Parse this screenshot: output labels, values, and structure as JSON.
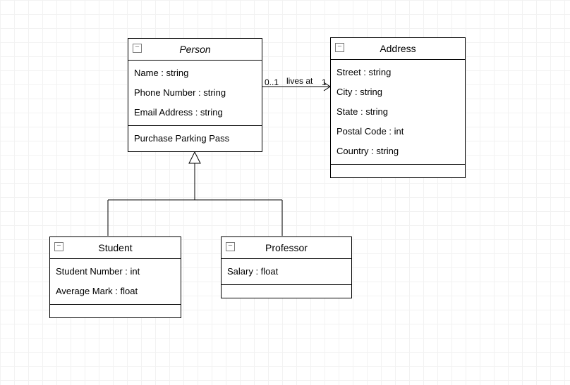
{
  "classes": {
    "person": {
      "name": "Person",
      "abstract": true,
      "attributes": [
        "Name : string",
        "Phone Number : string",
        "Email Address : string"
      ],
      "operations": [
        "Purchase Parking Pass"
      ]
    },
    "address": {
      "name": "Address",
      "abstract": false,
      "attributes": [
        "Street : string",
        "City : string",
        "State : string",
        "Postal Code : int",
        "Country : string"
      ],
      "operations": []
    },
    "student": {
      "name": "Student",
      "abstract": false,
      "attributes": [
        "Student Number : int",
        "Average Mark : float"
      ],
      "operations": []
    },
    "professor": {
      "name": "Professor",
      "abstract": false,
      "attributes": [
        "Salary : float"
      ],
      "operations": []
    }
  },
  "association": {
    "name": "lives at",
    "src_mult": "0..1",
    "dst_mult": "1"
  },
  "chart_data": {
    "type": "uml_class_diagram",
    "classes": [
      {
        "id": "Person",
        "abstract": true,
        "attributes": [
          {
            "name": "Name",
            "type": "string"
          },
          {
            "name": "Phone Number",
            "type": "string"
          },
          {
            "name": "Email Address",
            "type": "string"
          }
        ],
        "operations": [
          "Purchase Parking Pass"
        ]
      },
      {
        "id": "Address",
        "abstract": false,
        "attributes": [
          {
            "name": "Street",
            "type": "string"
          },
          {
            "name": "City",
            "type": "string"
          },
          {
            "name": "State",
            "type": "string"
          },
          {
            "name": "Postal Code",
            "type": "int"
          },
          {
            "name": "Country",
            "type": "string"
          }
        ],
        "operations": []
      },
      {
        "id": "Student",
        "abstract": false,
        "attributes": [
          {
            "name": "Student Number",
            "type": "int"
          },
          {
            "name": "Average Mark",
            "type": "float"
          }
        ],
        "operations": []
      },
      {
        "id": "Professor",
        "abstract": false,
        "attributes": [
          {
            "name": "Salary",
            "type": "float"
          }
        ],
        "operations": []
      }
    ],
    "relations": [
      {
        "type": "association",
        "from": "Person",
        "to": "Address",
        "name": "lives at",
        "from_mult": "0..1",
        "to_mult": "1",
        "navigable_to": true
      },
      {
        "type": "generalization",
        "parent": "Person",
        "child": "Student"
      },
      {
        "type": "generalization",
        "parent": "Person",
        "child": "Professor"
      }
    ]
  }
}
